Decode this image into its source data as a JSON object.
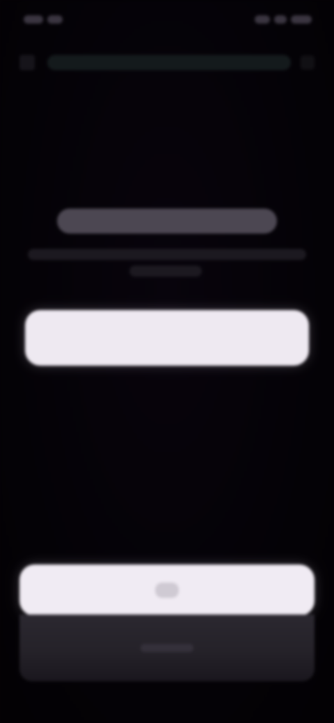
{
  "colors": {
    "background": "#050206",
    "button": "#eee9f1",
    "panel": "#28252d",
    "url_bar": "#141a1c"
  },
  "icons": {
    "back": "chevron-left",
    "close": "close"
  }
}
